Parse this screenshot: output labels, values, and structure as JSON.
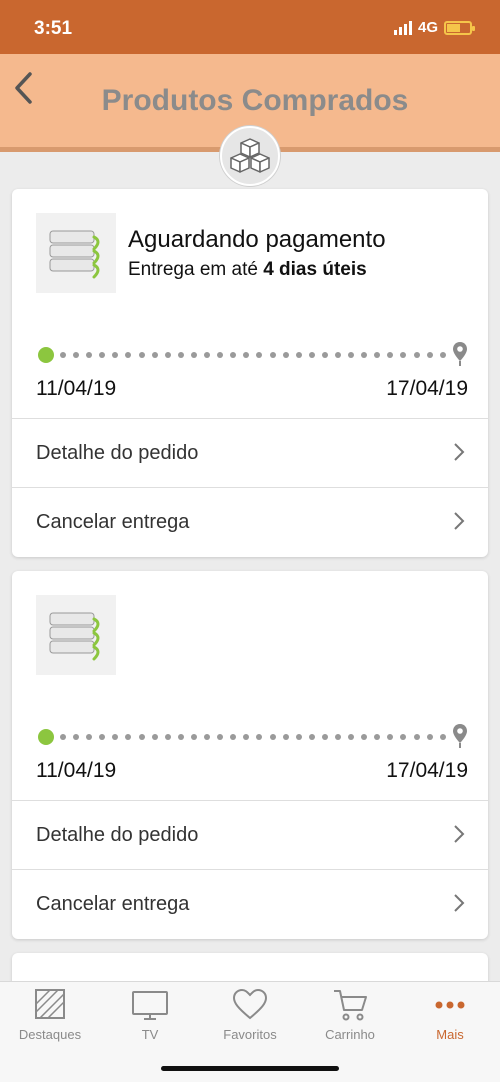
{
  "status_bar": {
    "time": "3:51",
    "network": "4G"
  },
  "header": {
    "title": "Produtos Comprados"
  },
  "orders": [
    {
      "status": "Aguardando pagamento",
      "delivery_prefix": "Entrega em até ",
      "delivery_days": "4 dias úteis",
      "start_date": "11/04/19",
      "end_date": "17/04/19",
      "actions": [
        "Detalhe do pedido",
        "Cancelar entrega"
      ]
    },
    {
      "status": "",
      "delivery_prefix": "",
      "delivery_days": "",
      "start_date": "11/04/19",
      "end_date": "17/04/19",
      "actions": [
        "Detalhe do pedido",
        "Cancelar entrega"
      ]
    }
  ],
  "nav": [
    {
      "label": "Destaques",
      "icon": "featured-icon"
    },
    {
      "label": "TV",
      "icon": "tv-icon"
    },
    {
      "label": "Favoritos",
      "icon": "heart-icon"
    },
    {
      "label": "Carrinho",
      "icon": "cart-icon"
    },
    {
      "label": "Mais",
      "icon": "more-icon",
      "active": true
    }
  ],
  "colors": {
    "brand": "#c9672f",
    "header_bg": "#f5b98e",
    "progress_start": "#8cc63f"
  }
}
